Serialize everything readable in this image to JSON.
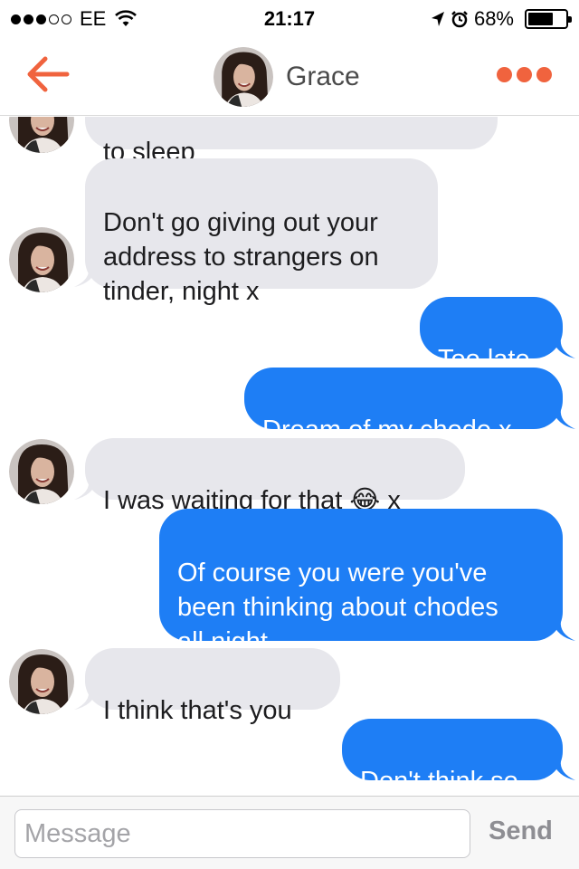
{
  "status_bar": {
    "carrier": "EE",
    "time": "21:17",
    "battery": "68%",
    "battery_level": 0.68,
    "signal_bars_filled": 3,
    "signal_bars_total": 5,
    "icons": [
      "signal-dots-icon",
      "wifi-icon",
      "location-arrow-icon",
      "alarm-clock-icon",
      "battery-icon"
    ]
  },
  "header": {
    "contact_name": "Grace",
    "back_icon": "arrow-left-icon",
    "more_icon": "ellipsis-icon",
    "accent_color": "#f0633e"
  },
  "conversation": {
    "messages": [
      {
        "sender": "them",
        "text": "to sleep",
        "cut_off": true
      },
      {
        "sender": "them",
        "text": "Don't go giving out your\naddress to strangers on\ntinder, night x"
      },
      {
        "sender": "me",
        "text": "Too late"
      },
      {
        "sender": "me",
        "text": "Dream of my chode x"
      },
      {
        "sender": "them",
        "text": "I was waiting for that 😂 x"
      },
      {
        "sender": "me",
        "text": "Of course you were you've\nbeen thinking about chodes\nall night"
      },
      {
        "sender": "them",
        "text": "I think that's you"
      },
      {
        "sender": "me",
        "text": "Don't think so"
      }
    ],
    "incoming_color": "#e7e7ec",
    "outgoing_color": "#1e7ef5"
  },
  "composer": {
    "placeholder": "Message",
    "value": "",
    "send_label": "Send"
  }
}
